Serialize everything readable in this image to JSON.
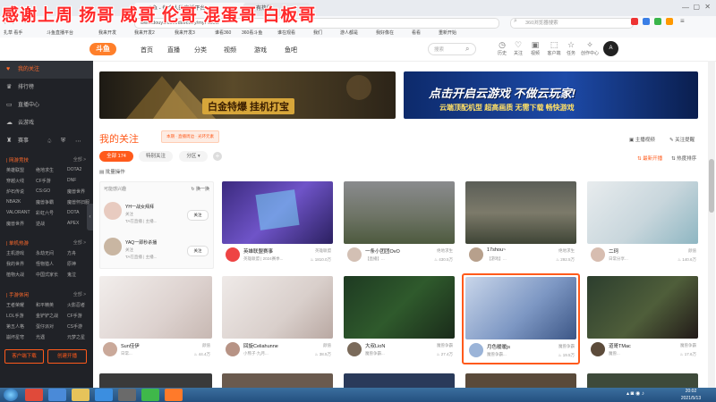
{
  "overlay": {
    "text": "感谢上周  扬哥 威哥  伦哥  混蛋哥 白板哥"
  },
  "browser": {
    "tabs": [
      {
        "label": "斗鱼 - 每个人的直播平台"
      },
      {
        "label": "有热门"
      }
    ],
    "address": "www.douyu.com/directory/myFollow",
    "search_placeholder": "360浏览器搜索",
    "bookmarks": [
      "扎草 看手",
      "斗鱼直播平台",
      "我来开发",
      "我来开发2",
      "我来开发3",
      "谁看360",
      "360看斗鱼",
      "谁在观看",
      "我们",
      "游人都是",
      "我好像在",
      "看看",
      "重新开始"
    ]
  },
  "site": {
    "logo": "斗鱼",
    "nav": [
      "首页",
      "直播",
      "分类",
      "视频",
      "游戏",
      "鱼吧"
    ],
    "search_placeholder": "搜索",
    "header_icons": [
      {
        "name": "history-icon",
        "label": "历史"
      },
      {
        "name": "heart-icon",
        "label": "关注"
      },
      {
        "name": "video-icon",
        "label": "视频"
      },
      {
        "name": "bell-icon",
        "label": "客户端"
      },
      {
        "name": "star-icon",
        "label": "任务"
      },
      {
        "name": "bulb-icon",
        "label": "创作中心"
      }
    ],
    "user_avatar_label": "A"
  },
  "sidebar": {
    "menu": [
      {
        "label": "我的关注",
        "icon": "heart-icon"
      },
      {
        "label": "排行榜",
        "icon": "trophy-icon"
      },
      {
        "label": "直播中心",
        "icon": "tv-icon"
      },
      {
        "label": "云游戏",
        "icon": "cloud-icon"
      }
    ],
    "sub_menu": [
      "赛事",
      "活动",
      "更多"
    ],
    "sections": [
      {
        "title": "| 网游竞技",
        "more": "全部 >",
        "items": [
          "英雄联盟",
          "绝地求生",
          "DOTA2",
          "穿越火线",
          "CF手游",
          "DNF",
          "炉石传说",
          "CS:GO",
          "魔兽世界",
          "NBA2K",
          "魔兽争霸",
          "魔兽怀旧服",
          "VALORANT",
          "彩虹六号",
          "DOTA",
          "魔兽世界",
          "逆战",
          "APEX"
        ]
      },
      {
        "title": "| 单机热游",
        "more": "全部 >",
        "items": [
          "主机游戏",
          "永劫无间",
          "方舟",
          "我的世界",
          "怪物猎人",
          "原神",
          "植物大战",
          "中国式家长",
          "鬼泣"
        ]
      },
      {
        "title": "| 手游休闲",
        "more": "全部 >",
        "items": [
          "王者荣耀",
          "和平精英",
          "火影忍者",
          "LOL手游",
          "金铲铲之战",
          "CF手游",
          "第五人格",
          "蛋仔派对",
          "CS手游",
          "崩坏星穹",
          "光遇",
          "元梦之星"
        ]
      }
    ],
    "buttons": [
      "客户端下载",
      "创建开播"
    ]
  },
  "main": {
    "banner_left_text": "白金特爆 挂机打宝",
    "banner_right_text": "点击开启云游戏  不做云玩家!",
    "banner_right_sub": "云端顶配机型 超高画质 无需下载 畅快游戏",
    "section_title": "我的关注",
    "badge_text": "本期 · 直播周边 · 光环元素",
    "top_right": [
      "主播视频",
      "关注提醒"
    ],
    "filters": {
      "all": "全部 174",
      "special": "特别关注",
      "group": "分区"
    },
    "batch_label": "批量操作",
    "sort_labels": [
      "最新开播",
      "热度排序"
    ],
    "recommend": {
      "title": "可能感兴趣",
      "refresh": "换一换",
      "items": [
        {
          "name": "YH一战女拜拜",
          "sub": "关注",
          "desc": "TA在直播 | 主播...",
          "follow": "关注"
        },
        {
          "name": "YAQ一即秒杀播",
          "sub": "关注",
          "desc": "TA在直播 | 主播...",
          "follow": "关注"
        }
      ]
    },
    "cards": [
      {
        "title": "英雄联盟赛事",
        "sub": "英雄联盟 | 2024赛季...",
        "cat": "英雄联盟",
        "count": "1810.0万"
      },
      {
        "title": "一条小团团OvO",
        "sub": "【直播】...",
        "cat": "绝地求生",
        "count": "430.5万"
      },
      {
        "title": "17shou~",
        "sub": "【游戏】...",
        "cat": "绝地求生",
        "count": "292.5万"
      },
      {
        "title": "二珂",
        "sub": "日常分享...",
        "cat": "颜值",
        "count": "140.6万"
      },
      {
        "title": "Sun佳伊",
        "sub": "日常...",
        "cat": "颜值",
        "count": "44.4万"
      },
      {
        "title": "回旋Celiahunne",
        "sub": "小熊子·九月...",
        "cat": "颜值",
        "count": "38.5万"
      },
      {
        "title": "大叔LioN",
        "sub": "魔兽争霸...",
        "cat": "魔兽争霸",
        "count": "27.4万"
      },
      {
        "title": "月色暖暖js",
        "sub": "魔兽争霸...",
        "cat": "魔兽争霸",
        "count": "19.5万"
      },
      {
        "title": "道哥TMac",
        "sub": "魔兽...",
        "cat": "魔兽争霸",
        "count": "17.6万"
      }
    ]
  },
  "taskbar": {
    "clock_time": "20:02",
    "clock_date": "2021/5/13"
  }
}
